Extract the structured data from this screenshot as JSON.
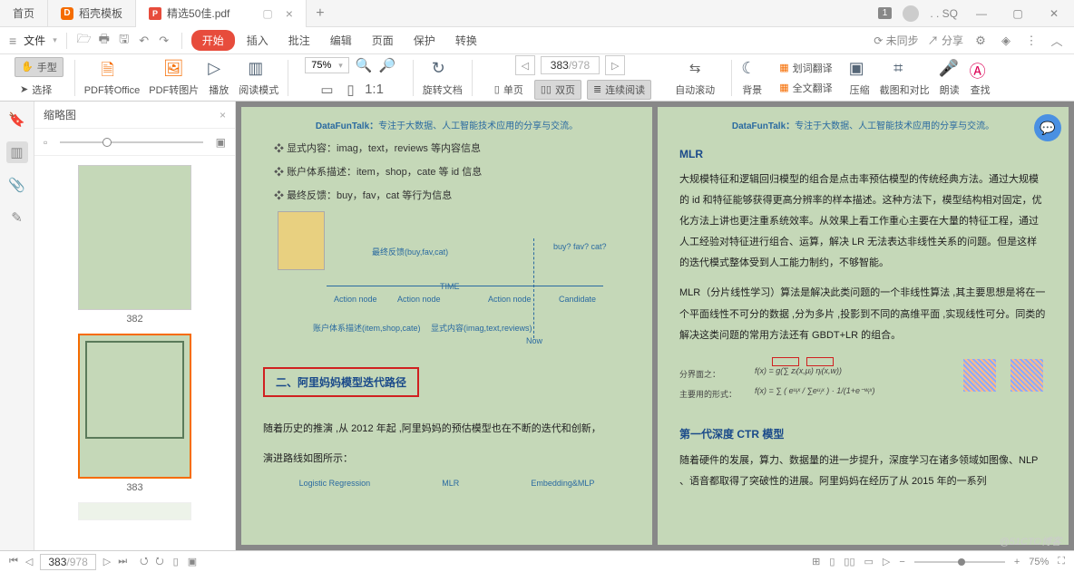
{
  "tabs": {
    "home": "首页",
    "tpl": "稻壳模板",
    "active": "精选50佳.pdf"
  },
  "titlebar": {
    "badge": "1",
    "user": ". . SQ"
  },
  "menubar": {
    "file": "文件",
    "items": [
      "开始",
      "插入",
      "批注",
      "编辑",
      "页面",
      "保护",
      "转换"
    ],
    "sync": "未同步",
    "share": "分享"
  },
  "toolbar": {
    "hand": "手型",
    "select": "选择",
    "pdf2office": "PDF转Office",
    "pdf2img": "PDF转图片",
    "play": "播放",
    "readmode": "阅读模式",
    "zoom": "75%",
    "rotate": "旋转文档",
    "single": "单页",
    "double": "双页",
    "continuous": "连续阅读",
    "autoscroll": "自动滚动",
    "bg": "背景",
    "chaduci": "划词翻译",
    "fulltrans": "全文翻译",
    "compress": "压缩",
    "screenshot": "截图和对比",
    "read": "朗读",
    "find": "查找",
    "page_current": "383",
    "page_total": "/978"
  },
  "thumbs": {
    "title": "缩略图",
    "p1": "382",
    "p2": "383"
  },
  "statusbar": {
    "page_current": "383",
    "page_total": "/978",
    "zoom": "75%",
    "watermark": "@51CTO博客"
  },
  "doc": {
    "watermark_brand": "DataFunTalk：",
    "watermark_rest": "专注于大数据、人工智能技术应用的分享与交流。",
    "left": {
      "b1": "显式内容：imag，text，reviews  等内容信息",
      "b2": "账户体系描述：item，shop，cate  等  id  信息",
      "b3": "最终反馈：buy，fav，cat 等行为信息",
      "diag": {
        "feedback": "最终反馈(buy,fav,cat)",
        "query": "buy? fav? cat?",
        "time": "TIME",
        "action": "Action node",
        "candidate": "Candidate",
        "account": "账户体系描述(item,shop,cate)",
        "explicit": "显式内容(imag,text,reviews)",
        "now": "Now"
      },
      "redbox": "二、阿里妈妈模型迭代路径",
      "p1": "随着历史的推演 ,从 2012 年起 ,阿里妈妈的预估模型也在不断的迭代和创新，",
      "p2": "演进路线如图所示：",
      "models": {
        "lr": "Logistic Regression",
        "mlr": "MLR",
        "emlp": "Embedding&MLP"
      }
    },
    "right": {
      "h1": "MLR",
      "p1": "大规模特征和逻辑回归模型的组合是点击率预估模型的传统经典方法。通过大规模的 id 和特征能够获得更高分辨率的样本描述。这种方法下，模型结构相对固定，优化方法上讲也更注重系统效率。从效果上看工作重心主要在大量的特征工程，通过人工经验对特征进行组合、运算，解决 LR 无法表达非线性关系的问题。但是这样的迭代模式整体受到人工能力制约，不够智能。",
      "p2": "MLR（分片线性学习）算法是解决此类问题的一个非线性算法 ,其主要思想是将在一个平面线性不可分的数据 ,分为多片 ,投影到不同的高维平面 ,实现线性可分。同类的解决这类问题的常用方法还有 GBDT+LR 的组合。",
      "math1": "分界面之：",
      "math2": "主要用的形式：",
      "h2": "第一代深度 CTR 模型",
      "p3": "随着硬件的发展，算力、数据量的进一步提升，深度学习在诸多领域如图像、NLP 、语音都取得了突破性的进展。阿里妈妈在经历了从 2015 年的一系列"
    }
  }
}
